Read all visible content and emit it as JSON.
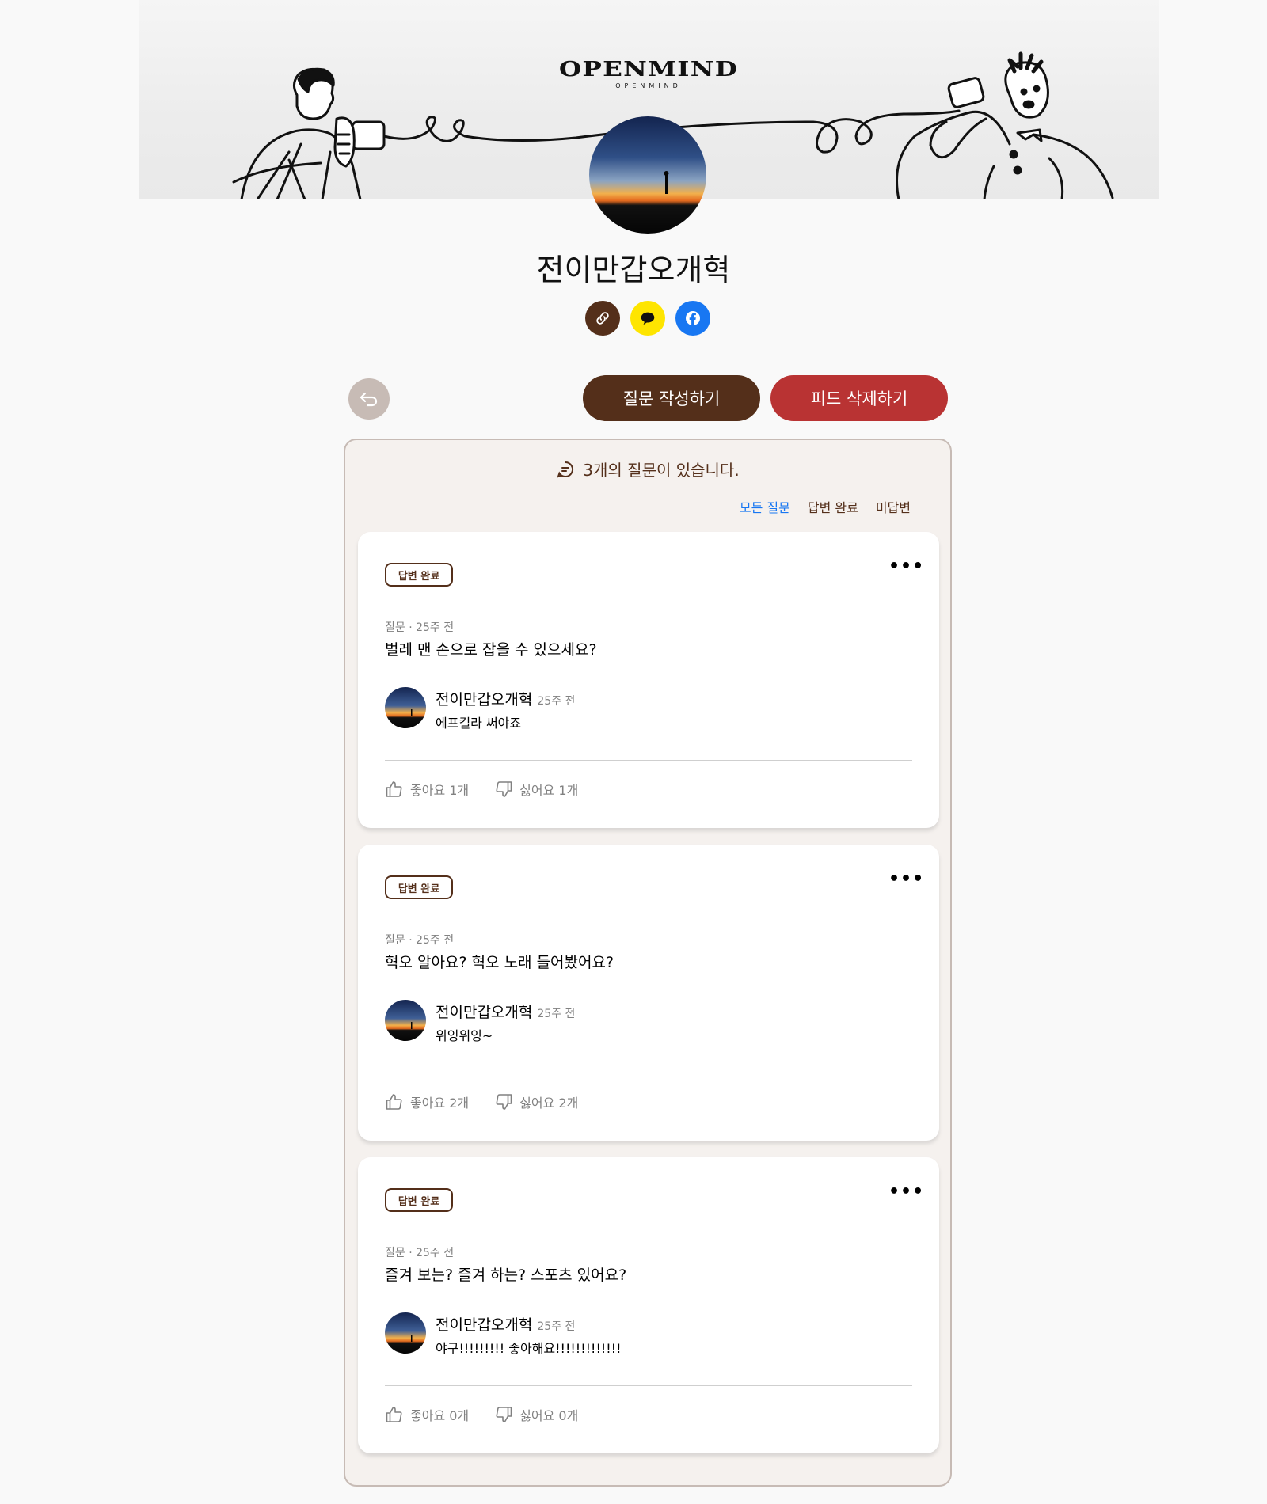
{
  "header": {
    "logo_main": "OPENMIND",
    "logo_sub": "OPENMIND"
  },
  "profile": {
    "name": "전이만갑오개혁",
    "share_buttons": [
      {
        "icon": "link-icon",
        "color": "#542f1a"
      },
      {
        "icon": "kakaotalk-icon",
        "color": "#fee500"
      },
      {
        "icon": "facebook-icon",
        "color": "#1877f2"
      }
    ]
  },
  "actions": {
    "back_icon": "arrow-back-icon",
    "ask_label": "질문 작성하기",
    "delete_label": "피드 삭제하기"
  },
  "feed": {
    "count_text": "3개의 질문이 있습니다.",
    "filters": [
      "모든 질문",
      "답변 완료",
      "미답변"
    ],
    "cards": [
      {
        "badge": "답변 완료",
        "meta": "질문 · 25주 전",
        "question": "벌레 맨 손으로 잡을 수 있으세요?",
        "answerer": "전이만갑오개혁",
        "answer_time": "25주 전",
        "answer": "에프킬라 써야죠",
        "like": "좋아요 1개",
        "dislike": "싫어요 1개"
      },
      {
        "badge": "답변 완료",
        "meta": "질문 · 25주 전",
        "question": "혁오 알아요? 혁오 노래 들어봤어요?",
        "answerer": "전이만갑오개혁",
        "answer_time": "25주 전",
        "answer": "위잉위잉~",
        "like": "좋아요 2개",
        "dislike": "싫어요 2개"
      },
      {
        "badge": "답변 완료",
        "meta": "질문 · 25주 전",
        "question": "즐겨 보는? 즐겨 하는? 스포츠 있어요?",
        "answerer": "전이만갑오개혁",
        "answer_time": "25주 전",
        "answer": "야구!!!!!!!!! 좋아해요!!!!!!!!!!!!!",
        "like": "좋아요 0개",
        "dislike": "싫어요 0개"
      }
    ]
  },
  "colors": {
    "brown": "#542f1a",
    "red": "#b93333",
    "blue": "#1877f2",
    "gray": "#818181",
    "feed_bg": "#f5f1ee",
    "border": "#c7bbb5"
  }
}
